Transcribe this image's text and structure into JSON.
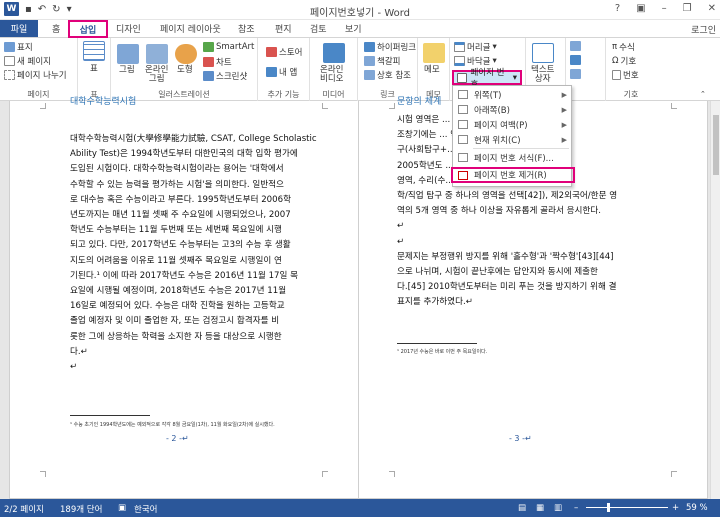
{
  "titlebar": {
    "title": "페이지번호넣기 - Word",
    "undo_icon": "↶",
    "redo_icon": "↻",
    "minimize": "–",
    "restore": "❐",
    "close": "✕"
  },
  "tabs": {
    "file": "파일",
    "home": "홈",
    "insert": "삽입",
    "design": "디자인",
    "layout": "페이지 레이아웃",
    "references": "참조",
    "mailings": "편지",
    "review": "검토",
    "view": "보기",
    "login": "로그인"
  },
  "ribbon": {
    "pages": {
      "cover": "표지",
      "new_page": "새 페이지",
      "page_break": "페이지 나누기",
      "label": "페이지"
    },
    "tables": {
      "table": "표",
      "label": "표"
    },
    "illustrations": {
      "picture": "그림",
      "online_picture": "온라인\n그림",
      "shapes": "도형",
      "smartart": "SmartArt",
      "chart": "차트",
      "screenshot": "스크린샷",
      "label": "일러스트레이션"
    },
    "addins": {
      "store": "스토어",
      "my_addins": "내 앱",
      "label": "추가 기능"
    },
    "media": {
      "online_video": "온라인\n비디오",
      "label": "미디어"
    },
    "links": {
      "hyperlink": "하이퍼링크",
      "bookmark": "책갈피",
      "crossref": "상호 참조",
      "label": "링크"
    },
    "comments": {
      "comment": "메모",
      "label": "메모"
    },
    "header_footer": {
      "header": "머리글",
      "footer": "바닥글",
      "page_number": "페이지 번호"
    },
    "text": {
      "textbox": "텍스트\n상자"
    },
    "symbols": {
      "equation": "수식",
      "symbol": "기호",
      "number": "번호",
      "label": "기호"
    }
  },
  "page_number_menu": {
    "items": [
      {
        "label": "위쪽(T)",
        "submenu": true
      },
      {
        "label": "아래쪽(B)",
        "submenu": true
      },
      {
        "label": "페이지 여백(P)",
        "submenu": true
      },
      {
        "label": "현재 위치(C)",
        "submenu": true
      },
      {
        "label": "페이지 번호 서식(F)...",
        "submenu": false
      },
      {
        "label": "페이지 번호 제거(R)",
        "submenu": false
      }
    ]
  },
  "left_page": {
    "heading": "대학수학능력시험",
    "lines": [
      "대학수학능력시험(大學修學能力試驗, CSAT, College Scholastic",
      "Ability Test)은 1994학년도부터 대한민국의 대학 입학 평가에",
      "도입된 시험이다. 대학수학능력시험이라는 용어는 '대학에서",
      "수학할 수 있는 능력을 평가하는 시험'을 의미한다. 일반적으",
      "로 대수능 혹은 수능이라고 부른다. 1995학년도부터 2006학",
      "년도까지는 매년 11월 셋째 주 수요일에 시행되었으나, 2007",
      "학년도 수능부터는 11월 두번째 또는 세번째 목요일에 시행",
      "되고 있다. 다만, 2017학년도 수능부터는 고3의 수능 후 생활",
      "지도의 어려움을 이유로 11월 셋째주 목요일로 시행일이 연",
      "기된다.¹ 이에 따라 2017학년도 수능은 2016년 11월 17일 목",
      "요일에 시행될 예정이며, 2018학년도 수능은 2017년 11월",
      "16일로 예정되어 있다. 수능은 대학 진학을 원하는 고등학교",
      "졸업 예정자 및 이미 졸업한 자, 또는 검정고시 합격자를 비",
      "롯한 그에 상응하는 학력을 소지한 자 등을 대상으로 시행한",
      "다.↵",
      "↵"
    ],
    "footnote": "¹ 수능 초기인 1994학년도에는 예외적으로 각각 8월 금요일(1차), 11월 화요일(2차)에 실시했다.",
    "page_number": "- 2 -↵"
  },
  "right_page": {
    "heading": "문항의 체계",
    "lines": [
      "시험 영역은 ...                        대체로 비슷하다.",
      "조창기에는 ...                   역(언어, 수리, 탐",
      "구(사회탐구+...                 응시해야 했으나,",
      "2005학년도 ...                       들은 언어(국어)",
      "영역, 수리(수...                  탐구 영역(사회/과",
      "학/직업 탐구 중 하나의 영역을 선택[42]), 제2외국어/한문 영",
      "역의 5개 영역 중 하나 이상을 자유롭게 골라서 응시한다.",
      "↵",
      "↵",
      "문제지는 부정행위 방지를 위해 '홀수형'과 '짝수형'[43][44]",
      "으로 나뉘며, 시험이 끝난후에는 답안지와 동시에 제출한",
      "다.[45] 2010학년도부터는 미리 푸는 것을 방지하기 위해 결",
      "표지를 추가하였다.↵"
    ],
    "footnote": "¹ 2017년 수능은 바로 이번 주 목요일이다.",
    "page_number": "- 3 -↵"
  },
  "statusbar": {
    "page": "2/2 페이지",
    "words": "189개 단어",
    "language": "한국어",
    "zoom": "59 %",
    "zoom_level": 0.59
  },
  "colors": {
    "accent": "#2b579a",
    "highlight": "#e0007a",
    "menu_hover": "#cde6f7"
  }
}
